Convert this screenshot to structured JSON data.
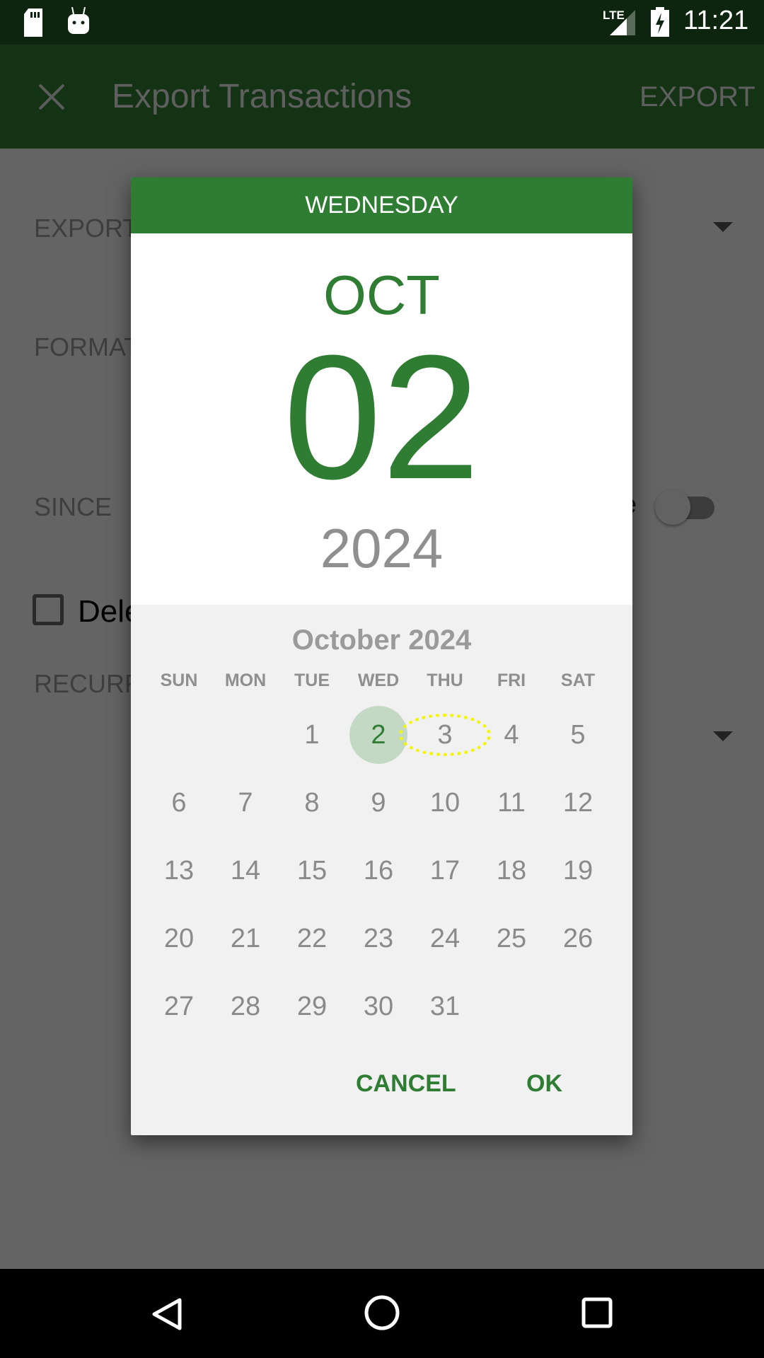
{
  "status_bar": {
    "time": "11:21",
    "network": "LTE",
    "icons": [
      "sd-card-icon",
      "android-icon",
      "signal-icon",
      "battery-charging-icon"
    ]
  },
  "toolbar": {
    "title": "Export Transactions",
    "action": "EXPORT",
    "close_icon": "close-icon"
  },
  "background_form": {
    "export_label": "EXPORT",
    "format_label": "FORMAT",
    "since_label": "SINCE",
    "since_toggle_text": "e",
    "delete_label": "Dele",
    "recurrence_label": "RECURR"
  },
  "dialog": {
    "weekday": "WEDNESDAY",
    "month": "OCT",
    "day": "02",
    "year": "2024",
    "month_title": "October 2024",
    "weekdays": [
      "SUN",
      "MON",
      "TUE",
      "WED",
      "THU",
      "FRI",
      "SAT"
    ],
    "first_weekday_index": 2,
    "days": [
      "1",
      "2",
      "3",
      "4",
      "5",
      "6",
      "7",
      "8",
      "9",
      "10",
      "11",
      "12",
      "13",
      "14",
      "15",
      "16",
      "17",
      "18",
      "19",
      "20",
      "21",
      "22",
      "23",
      "24",
      "25",
      "26",
      "27",
      "28",
      "29",
      "30",
      "31"
    ],
    "selected_day": "2",
    "highlighted_day": "3",
    "cancel": "CANCEL",
    "ok": "OK",
    "accent": "#2e7d32"
  },
  "nav_bar": {
    "icons": [
      "back-icon",
      "home-icon",
      "recents-icon"
    ]
  }
}
